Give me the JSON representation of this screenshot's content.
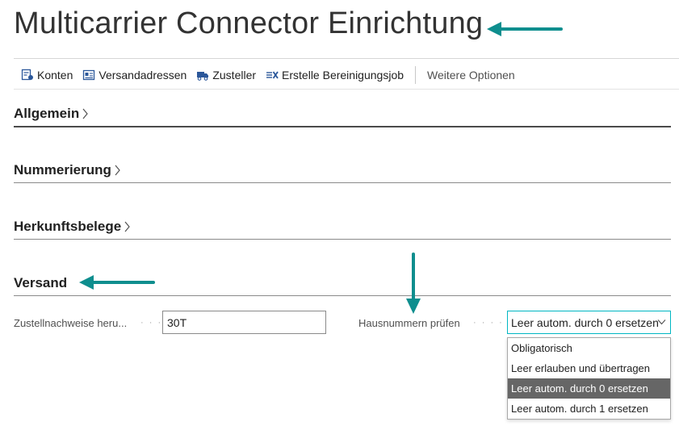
{
  "page": {
    "title": "Multicarrier Connector Einrichtung"
  },
  "toolbar": {
    "actions": [
      {
        "label": "Konten",
        "icon": "accounts-icon"
      },
      {
        "label": "Versandadressen",
        "icon": "shipping-addresses-icon"
      },
      {
        "label": "Zusteller",
        "icon": "carrier-icon"
      },
      {
        "label": "Erstelle Bereinigungsjob",
        "icon": "cleanup-job-icon"
      }
    ],
    "more_label": "Weitere Optionen"
  },
  "sections": {
    "allgemein": "Allgemein",
    "nummerierung": "Nummerierung",
    "herkunftsbelege": "Herkunftsbelege",
    "versand": "Versand"
  },
  "versand": {
    "zustellnachweise_label": "Zustellnachweise heru...",
    "zustellnachweise_value": "30T",
    "hausnummern_label": "Hausnummern prüfen",
    "hausnummern_value": "Leer autom. durch 0 ersetzen",
    "hausnummern_options": [
      "Obligatorisch",
      "Leer erlauben und übertragen",
      "Leer autom. durch 0 ersetzen",
      "Leer autom. durch 1 ersetzen"
    ],
    "selected_option_index": 2
  },
  "colors": {
    "accent": "#00b7c3",
    "arrow": "#0e8e8e",
    "selected_bg": "#666666"
  }
}
